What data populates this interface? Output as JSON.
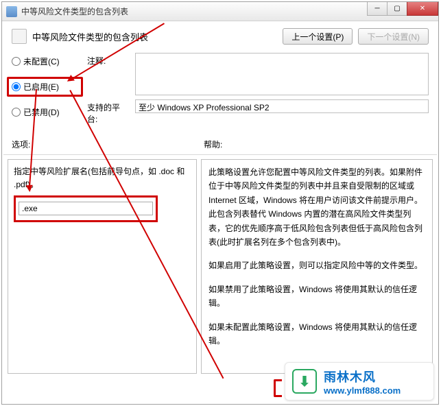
{
  "window": {
    "title": "中等风险文件类型的包含列表"
  },
  "header": {
    "title": "中等风险文件类型的包含列表",
    "prev_button": "上一个设置(P)",
    "next_button": "下一个设置(N)"
  },
  "config": {
    "radio_not_configured": "未配置(C)",
    "radio_enabled": "已启用(E)",
    "radio_disabled": "已禁用(D)",
    "selected": "enabled",
    "comment_label": "注释:",
    "comment_value": "",
    "platform_label": "支持的平台:",
    "platform_value": "至少 Windows XP Professional SP2"
  },
  "sections": {
    "options_label": "选项:",
    "help_label": "帮助:"
  },
  "options": {
    "description": "指定中等风险扩展名(包括前导句点，如 .doc 和 .pdf)。",
    "input_value": ".exe"
  },
  "help": {
    "p1": "此策略设置允许您配置中等风险文件类型的列表。如果附件位于中等风险文件类型的列表中并且来自受限制的区域或 Internet 区域，Windows 将在用户访问该文件前提示用户。此包含列表替代 Windows 内置的潜在高风险文件类型列表，它的优先顺序高于低风险包含列表但低于高风险包含列表(此时扩展名列在多个包含列表中)。",
    "p2": "如果启用了此策略设置，则可以指定风险中等的文件类型。",
    "p3": "如果禁用了此策略设置，Windows 将使用其默认的信任逻辑。",
    "p4": "如果未配置此策略设置，Windows 将使用其默认的信任逻辑。"
  },
  "watermark": {
    "title": "雨林木风",
    "url": "www.ylmf888.com",
    "icon_char": "⬇"
  }
}
